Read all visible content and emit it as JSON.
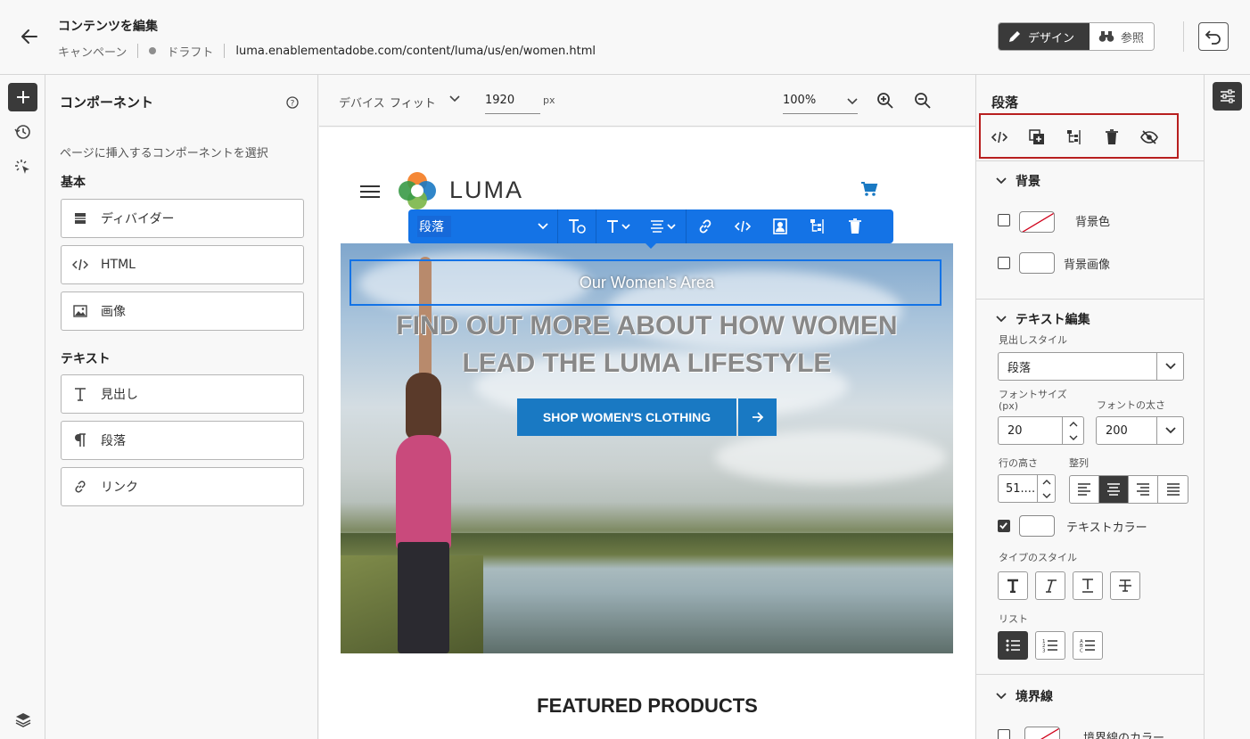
{
  "header": {
    "title": "コンテンツを編集",
    "type": "キャンペーン",
    "status": "ドラフト",
    "url": "luma.enablementadobe.com/content/luma/us/en/women.html",
    "design_label": "デザイン",
    "view_label": "参照"
  },
  "components": {
    "title": "コンポーネント",
    "description": "ページに挿入するコンポーネントを選択",
    "basic_label": "基本",
    "basic_items": [
      "ディバイダー",
      "HTML",
      "画像"
    ],
    "text_label": "テキスト",
    "text_items": [
      "見出し",
      "段落",
      "リンク"
    ]
  },
  "canvas": {
    "device_label": "デバイス",
    "device_value": "フィット",
    "width_value": "1920",
    "width_unit": "px",
    "zoom_value": "100%"
  },
  "page": {
    "logo_text": "LUMA",
    "hero_subtitle": "Our Women's Area",
    "hero_line1": "FIND OUT MORE ABOUT HOW WOMEN",
    "hero_line2": "LEAD THE LUMA LIFESTYLE",
    "shop_button": "SHOP WOMEN'S CLOTHING",
    "featured": "FEATURED PRODUCTS"
  },
  "floating_toolbar": {
    "type_label": "段落"
  },
  "properties": {
    "title": "段落",
    "background_section": "背景",
    "bg_color_label": "背景色",
    "bg_image_label": "背景画像",
    "text_section": "テキスト編集",
    "heading_style_label": "見出しスタイル",
    "heading_style_value": "段落",
    "font_size_label": "フォントサイズ (px)",
    "font_size_value": "20",
    "font_weight_label": "フォントの太さ",
    "font_weight_value": "200",
    "line_height_label": "行の高さ",
    "line_height_value": "51....",
    "align_label": "整列",
    "text_color_label": "テキストカラー",
    "type_style_label": "タイプのスタイル",
    "list_label": "リスト",
    "border_section": "境界線",
    "border_color_label": "境界線のカラー"
  },
  "colors": {
    "accent": "#1473e6",
    "highlight": "#b81f1f",
    "shop_button": "#1979c3"
  }
}
